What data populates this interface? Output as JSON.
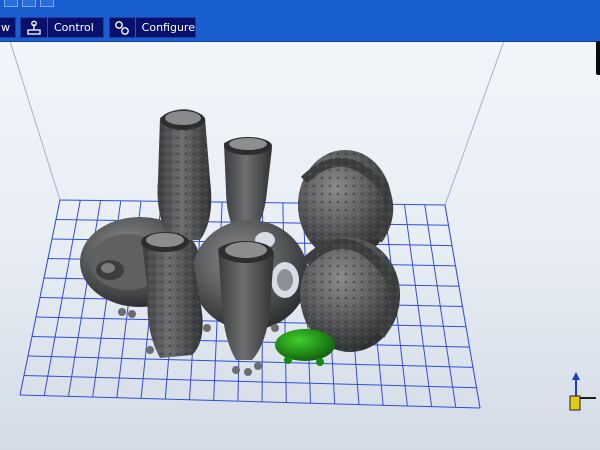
{
  "toolbar": {
    "view_label": "w",
    "control_label": "Control",
    "configure_label": "Configure"
  },
  "colors": {
    "toolbar_bg": "#1a5fd0",
    "tab_bg": "#08106e",
    "grid_line": "#2f4fd8",
    "model_gray": "#4d4f50",
    "selected_model_green": "#1b8f16"
  },
  "icons": [
    "view-icon",
    "joystick-icon",
    "gears-icon",
    "axis-gizmo-icon"
  ]
}
